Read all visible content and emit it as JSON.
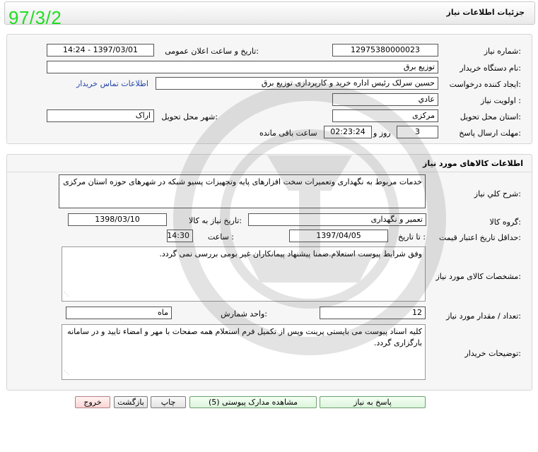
{
  "header": {
    "title": "جزئیات اطلاعات نیاز",
    "stamp": "97/3/2"
  },
  "need_info": {
    "need_number_label": "شماره نیاز:",
    "need_number": "12975380000023",
    "announce_label": "تاریخ و ساعت اعلان عمومی:",
    "announce_value": "1397/03/01 - 14:24",
    "buyer_org_label": "نام دستگاه خریدار:",
    "buyer_org": "توزیع برق",
    "requester_label": "ایجاد کننده درخواست:",
    "requester": "حسین سرلک رئیس اداره خرید و کارپردازی توزیع برق",
    "contact_link": "اطلاعات تماس خریدار",
    "priority_label": "اولویت نیاز :",
    "priority": "عادي",
    "province_label": "استان محل تحویل:",
    "province": "مرکزی",
    "city_label": "شهر محل تحویل:",
    "city": "اراک",
    "deadline_label": "مهلت ارسال پاسخ:",
    "days": "3",
    "days_suffix": "روز و",
    "time_left": "02:23:24",
    "time_suffix": "ساعت باقی مانده"
  },
  "goods": {
    "title": "اطلاعات کالاهای مورد نیاز",
    "summary_label": "شرح کلي نياز:",
    "summary": "خدمات مربوط به نگهداری وتعمیرات سخت افزارهای پایه وتجهیزات پسیو شبکه در شهرهای حوزه استان مرکزی",
    "group_label": "گروه کالا:",
    "group": "تعمیر و نگهداری",
    "need_date_label": "تاریخ نیاز به کالا:",
    "need_date": "1398/03/10",
    "min_price_label": "حداقل تاریخ اعتبار قیمت:",
    "until_date_label": "تا تاریخ :",
    "until_date": "1397/04/05",
    "time_label": "ساعت :",
    "time": "14:30",
    "specs_label": "مشخصات کالای مورد نیاز:",
    "specs": "وفق شرایط پیوست استعلام.ضمنا پیشنهاد پیمانکاران غیر بومی بررسی نمی گردد.",
    "qty_label": "تعداد / مقدار مورد نیاز:",
    "qty": "12",
    "unit_label": "واحد شمارش:",
    "unit": "ماه",
    "notes_label": "توضیحات خریدار:",
    "notes": "کلیه اسناد پیوست می بایستی پرینت وپس از تکمیل فرم استعلام همه صفحات با مهر و امضاء تایید و در سامانه بارگزاری گردد."
  },
  "buttons": {
    "reply": "پاسخ به نیاز",
    "attachments": "مشاهده مدارک پیوستی (5)",
    "print": "چاپ",
    "back": "بازگشت",
    "exit": "خروج"
  }
}
